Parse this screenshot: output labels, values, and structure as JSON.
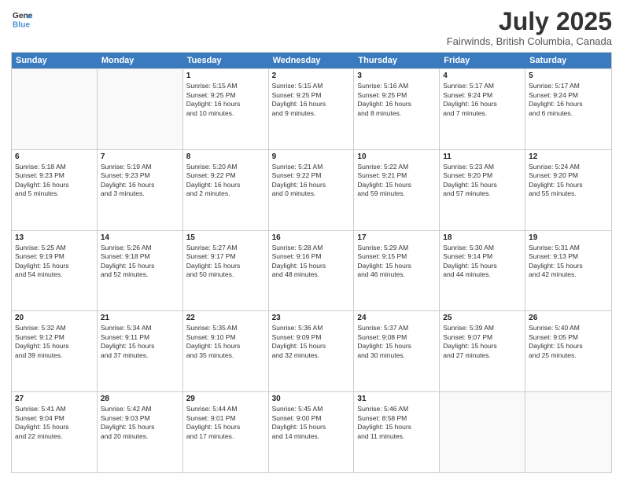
{
  "header": {
    "logo_line1": "General",
    "logo_line2": "Blue",
    "title": "July 2025",
    "subtitle": "Fairwinds, British Columbia, Canada"
  },
  "weekdays": [
    "Sunday",
    "Monday",
    "Tuesday",
    "Wednesday",
    "Thursday",
    "Friday",
    "Saturday"
  ],
  "rows": [
    [
      {
        "day": "",
        "info": ""
      },
      {
        "day": "",
        "info": ""
      },
      {
        "day": "1",
        "info": "Sunrise: 5:15 AM\nSunset: 9:25 PM\nDaylight: 16 hours\nand 10 minutes."
      },
      {
        "day": "2",
        "info": "Sunrise: 5:15 AM\nSunset: 9:25 PM\nDaylight: 16 hours\nand 9 minutes."
      },
      {
        "day": "3",
        "info": "Sunrise: 5:16 AM\nSunset: 9:25 PM\nDaylight: 16 hours\nand 8 minutes."
      },
      {
        "day": "4",
        "info": "Sunrise: 5:17 AM\nSunset: 9:24 PM\nDaylight: 16 hours\nand 7 minutes."
      },
      {
        "day": "5",
        "info": "Sunrise: 5:17 AM\nSunset: 9:24 PM\nDaylight: 16 hours\nand 6 minutes."
      }
    ],
    [
      {
        "day": "6",
        "info": "Sunrise: 5:18 AM\nSunset: 9:23 PM\nDaylight: 16 hours\nand 5 minutes."
      },
      {
        "day": "7",
        "info": "Sunrise: 5:19 AM\nSunset: 9:23 PM\nDaylight: 16 hours\nand 3 minutes."
      },
      {
        "day": "8",
        "info": "Sunrise: 5:20 AM\nSunset: 9:22 PM\nDaylight: 16 hours\nand 2 minutes."
      },
      {
        "day": "9",
        "info": "Sunrise: 5:21 AM\nSunset: 9:22 PM\nDaylight: 16 hours\nand 0 minutes."
      },
      {
        "day": "10",
        "info": "Sunrise: 5:22 AM\nSunset: 9:21 PM\nDaylight: 15 hours\nand 59 minutes."
      },
      {
        "day": "11",
        "info": "Sunrise: 5:23 AM\nSunset: 9:20 PM\nDaylight: 15 hours\nand 57 minutes."
      },
      {
        "day": "12",
        "info": "Sunrise: 5:24 AM\nSunset: 9:20 PM\nDaylight: 15 hours\nand 55 minutes."
      }
    ],
    [
      {
        "day": "13",
        "info": "Sunrise: 5:25 AM\nSunset: 9:19 PM\nDaylight: 15 hours\nand 54 minutes."
      },
      {
        "day": "14",
        "info": "Sunrise: 5:26 AM\nSunset: 9:18 PM\nDaylight: 15 hours\nand 52 minutes."
      },
      {
        "day": "15",
        "info": "Sunrise: 5:27 AM\nSunset: 9:17 PM\nDaylight: 15 hours\nand 50 minutes."
      },
      {
        "day": "16",
        "info": "Sunrise: 5:28 AM\nSunset: 9:16 PM\nDaylight: 15 hours\nand 48 minutes."
      },
      {
        "day": "17",
        "info": "Sunrise: 5:29 AM\nSunset: 9:15 PM\nDaylight: 15 hours\nand 46 minutes."
      },
      {
        "day": "18",
        "info": "Sunrise: 5:30 AM\nSunset: 9:14 PM\nDaylight: 15 hours\nand 44 minutes."
      },
      {
        "day": "19",
        "info": "Sunrise: 5:31 AM\nSunset: 9:13 PM\nDaylight: 15 hours\nand 42 minutes."
      }
    ],
    [
      {
        "day": "20",
        "info": "Sunrise: 5:32 AM\nSunset: 9:12 PM\nDaylight: 15 hours\nand 39 minutes."
      },
      {
        "day": "21",
        "info": "Sunrise: 5:34 AM\nSunset: 9:11 PM\nDaylight: 15 hours\nand 37 minutes."
      },
      {
        "day": "22",
        "info": "Sunrise: 5:35 AM\nSunset: 9:10 PM\nDaylight: 15 hours\nand 35 minutes."
      },
      {
        "day": "23",
        "info": "Sunrise: 5:36 AM\nSunset: 9:09 PM\nDaylight: 15 hours\nand 32 minutes."
      },
      {
        "day": "24",
        "info": "Sunrise: 5:37 AM\nSunset: 9:08 PM\nDaylight: 15 hours\nand 30 minutes."
      },
      {
        "day": "25",
        "info": "Sunrise: 5:39 AM\nSunset: 9:07 PM\nDaylight: 15 hours\nand 27 minutes."
      },
      {
        "day": "26",
        "info": "Sunrise: 5:40 AM\nSunset: 9:05 PM\nDaylight: 15 hours\nand 25 minutes."
      }
    ],
    [
      {
        "day": "27",
        "info": "Sunrise: 5:41 AM\nSunset: 9:04 PM\nDaylight: 15 hours\nand 22 minutes."
      },
      {
        "day": "28",
        "info": "Sunrise: 5:42 AM\nSunset: 9:03 PM\nDaylight: 15 hours\nand 20 minutes."
      },
      {
        "day": "29",
        "info": "Sunrise: 5:44 AM\nSunset: 9:01 PM\nDaylight: 15 hours\nand 17 minutes."
      },
      {
        "day": "30",
        "info": "Sunrise: 5:45 AM\nSunset: 9:00 PM\nDaylight: 15 hours\nand 14 minutes."
      },
      {
        "day": "31",
        "info": "Sunrise: 5:46 AM\nSunset: 8:58 PM\nDaylight: 15 hours\nand 11 minutes."
      },
      {
        "day": "",
        "info": ""
      },
      {
        "day": "",
        "info": ""
      }
    ]
  ]
}
